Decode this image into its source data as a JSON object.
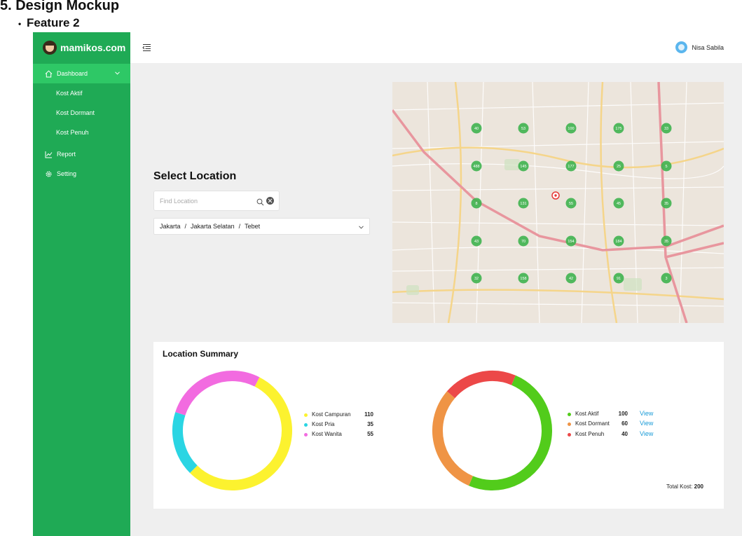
{
  "doc": {
    "heading": "5. Design Mockup",
    "bullet": "Feature 2"
  },
  "app": {
    "logo_text": "mamikos.com"
  },
  "sidebar": {
    "items": [
      {
        "label": "Dashboard"
      },
      {
        "label": "Report"
      },
      {
        "label": "Setting"
      }
    ],
    "subitems": [
      {
        "label": "Kost Aktif"
      },
      {
        "label": "Kost Dormant"
      },
      {
        "label": "Kost Penuh"
      }
    ]
  },
  "topbar": {
    "user_name": "Nisa Sabila"
  },
  "location": {
    "title": "Select Location",
    "search_placeholder": "Find Location",
    "path": [
      "Jakarta",
      "Jakarta Selatan",
      "Tebet"
    ],
    "separator": "/"
  },
  "map": {
    "markers": [
      "40",
      "53",
      "100",
      "175",
      "33",
      "488",
      "145",
      "177",
      "25",
      "5",
      "8",
      "131",
      "55",
      "45",
      "35",
      "43",
      "70",
      "154",
      "184",
      "35",
      "32",
      "158",
      "42",
      "91",
      "3"
    ]
  },
  "summary": {
    "title": "Location Summary",
    "total_label": "Total Kost:",
    "total_value": "200",
    "view_label": "View"
  },
  "chart_data": [
    {
      "type": "pie",
      "donut": true,
      "categories": [
        "Kost Campuran",
        "Kost Pria",
        "Kost Wanita"
      ],
      "values": [
        110,
        35,
        55
      ],
      "colors": [
        "#fcf22f",
        "#2ad5e3",
        "#f26be0"
      ]
    },
    {
      "type": "pie",
      "donut": true,
      "categories": [
        "Kost Aktif",
        "Kost Dormant",
        "Kost Penuh"
      ],
      "values": [
        100,
        60,
        40
      ],
      "colors": [
        "#52cc1b",
        "#ef9445",
        "#ec4848"
      ]
    }
  ]
}
